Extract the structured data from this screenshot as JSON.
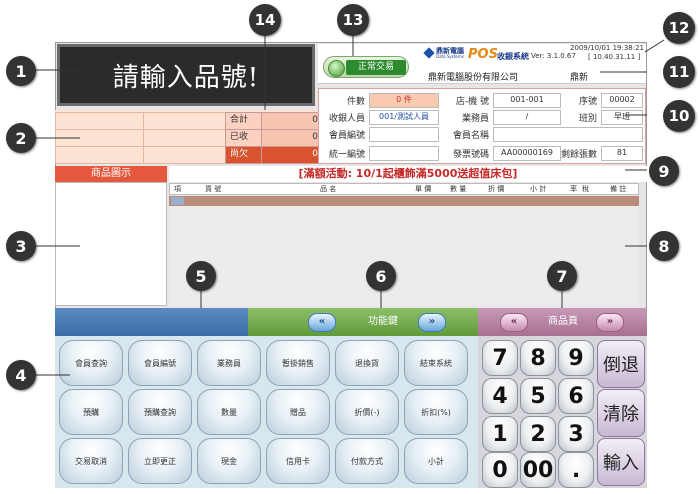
{
  "prompt": {
    "text": "請輸入品號!"
  },
  "totals": {
    "rows": [
      {
        "label": "合計",
        "value": "0"
      },
      {
        "label": "已收",
        "value": "0"
      },
      {
        "label": "尚欠",
        "value": "0"
      }
    ]
  },
  "status": {
    "label": "正常交易"
  },
  "system": {
    "logo_cn": "鼎新電腦",
    "logo_en": "Data Systems",
    "pos": "POS",
    "name": "收銀系統",
    "version": "Ver: 3.1.0.67",
    "datetime": "2009/10/01 19:38:21",
    "ip": "[ 10.40.31.11 ]",
    "company": "鼎新電腦股份有限公司",
    "user": "鼎新"
  },
  "info": {
    "count_label": "件數",
    "count_value": "0 件",
    "store_label": "店-機 號",
    "store_value": "001-001",
    "seq_label": "序號",
    "seq_value": "00002",
    "cashier_label": "收銀人員",
    "cashier_value": "001/測試人員",
    "sales_label": "業務員",
    "sales_value": "/",
    "shift_label": "班別",
    "shift_value": "早班",
    "member_no_label": "會員編號",
    "member_no_value": "",
    "member_name_label": "會員名稱",
    "member_name_value": "",
    "tax_label": "統一編號",
    "tax_value": "",
    "invoice_label": "發票號碼",
    "invoice_value": "AA00000169",
    "remain_label": "剩餘張數",
    "remain_value": "81"
  },
  "preview": {
    "title": "商品圖示"
  },
  "promo": {
    "text": "[滿額活動: 10/1起櫃飾滿5000送超值床包]"
  },
  "table": {
    "columns": [
      "項",
      "貨 號",
      "品 名",
      "單 價",
      "數 量",
      "折 價",
      "小 計",
      "率",
      "稅",
      "備 註"
    ]
  },
  "bars": {
    "function_title": "功能鍵",
    "product_title": "商品頁",
    "prev": "«",
    "next": "»"
  },
  "function_keys": [
    "會員查詢",
    "會員編號",
    "業務員",
    "暫掛銷售",
    "退換貨",
    "結束系統",
    "預購",
    "預購查詢",
    "數量",
    "贈品",
    "折價(-)",
    "折扣(%)",
    "交易取消",
    "立即更正",
    "現金",
    "信用卡",
    "付款方式",
    "小計"
  ],
  "keypad": {
    "digits": [
      "7",
      "8",
      "9",
      "4",
      "5",
      "6",
      "1",
      "2",
      "3",
      "0",
      "00",
      "."
    ],
    "side": [
      "倒退",
      "清除",
      "輸入"
    ]
  },
  "callouts": [
    "1",
    "2",
    "3",
    "4",
    "5",
    "6",
    "7",
    "8",
    "9",
    "10",
    "11",
    "12",
    "13",
    "14"
  ]
}
